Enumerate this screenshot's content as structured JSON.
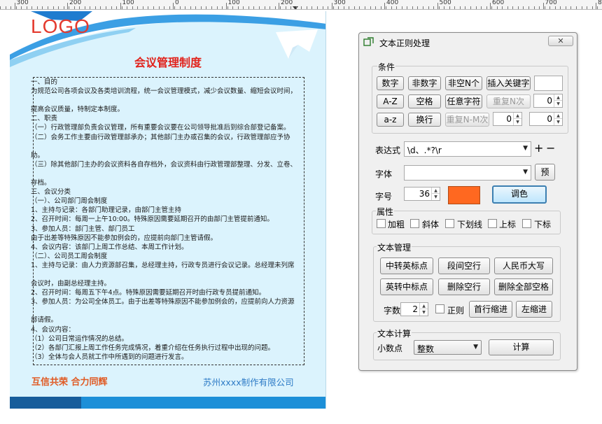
{
  "ruler": {
    "labels": [
      "300",
      "200",
      "100",
      "0",
      "100",
      "200",
      "300",
      "400",
      "500",
      "600",
      "700",
      "800"
    ]
  },
  "document": {
    "logo": "LOGO",
    "title": "会议管理制度",
    "body_lines": [
      "一、目的",
      "为规范公司各项会议及各类培训流程，统一会议管理模式，减少会议数量、缩短会议时间，",
      "",
      "提高会议质量，特制定本制度。",
      "二、职责",
      "（一）行政管理部负责会议管理，所有重要会议要在公司领导批准后到综合部登记备案。",
      "（二）会务工作主要由行政管理部承办；其他部门主办或召集的会议，行政管理部应予协",
      "",
      "助。",
      "（三）除其他部门主办的会议资料各自存档外，会议资料由行政管理部整理、分发、立卷、",
      "",
      "存档。",
      "三、会议分类",
      "（一）、公司部门周会制度",
      "1、主持与记录：各部门助理记录，由部门主管主持",
      "2、召开时间：每周一上午10:00。特殊原因需要延期召开的由部门主管提前通知。",
      "3、参加人员：部门主管、部门员工",
      "由于出差等特殊原因不能参加例会的，应提前向部门主管请假。",
      "4、会议内容：该部门上周工作总结、本周工作计划。",
      "（二）、公司员工周会制度",
      "1、主持与记录：由人力资源部召集，总经理主持，行政专员进行会议记录。总经理未列席",
      "",
      "会议时，由副总经理主持。",
      "2、召开时间：每周五下午4点。特殊原因需要延期召开时由行政专员提前通知。",
      "3、参加人员：为公司全体员工。由于出差等特殊原因不能参加例会的，应提前向人力资源",
      "",
      "部请假。",
      "4、会议内容：",
      "（1）公司日常运作情况的总结。",
      "（2）各部门汇报上周工作任务完成情况，着重介绍在任务执行过程中出现的问题。",
      "（3）全体与会人员就工作中所遇到的问题进行发言。"
    ],
    "slogan": "互信共荣 合力同辉",
    "company": "苏州xxxx制作有限公司",
    "colors": {
      "accent_red": "#e1221b",
      "slogan_orange": "#e05a23",
      "company_blue": "#2d7bc6",
      "bar_blue": "#1c8fd8",
      "bar_dark": "#175d9b",
      "page_bg": "#dbf3fd"
    }
  },
  "dialog": {
    "title": "文本正则处理",
    "close_label": "✕",
    "conditions": {
      "label": "条件",
      "row1": [
        "数字",
        "非数字",
        "非空N个",
        "插入关键字"
      ],
      "keyword_value": "",
      "row2": [
        "A-Z",
        "空格",
        "任意字符"
      ],
      "repeat_n_label": "重复N次",
      "repeat_n_value": "0",
      "row3": [
        "a-z",
        "换行"
      ],
      "repeat_nm_label": "重复N-M次",
      "repeat_n1_value": "0",
      "repeat_m_value": "0"
    },
    "expression": {
      "label": "表达式",
      "value": "\\d、.*?\\r",
      "plus": "+",
      "minus": "−"
    },
    "font": {
      "label": "字体",
      "value": "",
      "preview_label": "预"
    },
    "font_size": {
      "label": "字号",
      "value": "36",
      "color_swatch": "#ff6820",
      "color_button": "调色"
    },
    "attributes": {
      "label": "属性",
      "items": [
        "加粗",
        "斜体",
        "下划线",
        "上标",
        "下标"
      ]
    },
    "text_management": {
      "label": "文本管理",
      "row1": [
        "中转英标点",
        "段间空行",
        "人民币大写"
      ],
      "row2": [
        "英转中标点",
        "删除空行",
        "删除全部空格"
      ],
      "count_label": "字数",
      "count_value": "2",
      "reverse_label": "正则",
      "indent_first": "首行缩进",
      "indent_left": "左缩进"
    },
    "text_calc": {
      "label": "文本计算",
      "decimal_label": "小数点",
      "decimal_value": "整数",
      "calc_button": "计算"
    }
  }
}
